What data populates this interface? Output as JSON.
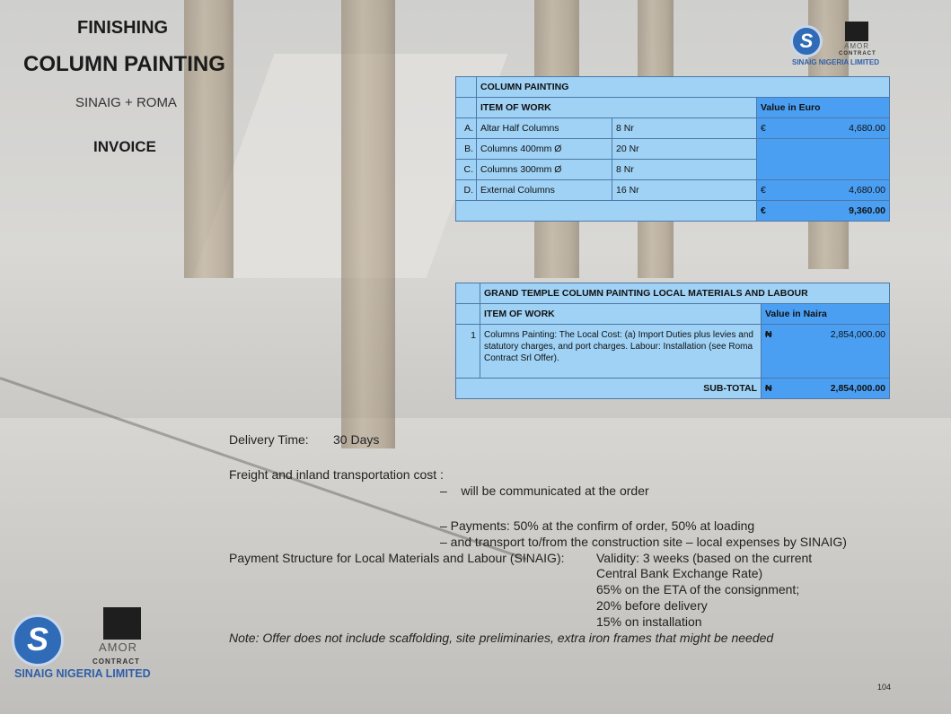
{
  "header": {
    "title_line1": "FINISHING",
    "title_line2": "COLUMN PAINTING",
    "subtitle": "SINAIG + ROMA",
    "doc_type": "INVOICE"
  },
  "logos": {
    "sinaig_name": "SINAIG NIGERIA LIMITED",
    "roma_word": "AMOR",
    "roma_contract": "CONTRACT",
    "badge_letter": "S"
  },
  "table1": {
    "title": "COLUMN PAINTING",
    "col_item": "ITEM OF WORK",
    "col_value": "Value in Euro",
    "rows": [
      {
        "idx": "A.",
        "item": "Altar Half Columns",
        "qty": "8 Nr",
        "cur": "€",
        "value": "4,680.00"
      },
      {
        "idx": "B.",
        "item": "Columns 400mm Ø",
        "qty": "20 Nr",
        "cur": "",
        "value": ""
      },
      {
        "idx": "C.",
        "item": "Columns 300mm Ø",
        "qty": "8 Nr",
        "cur": "",
        "value": ""
      },
      {
        "idx": "D.",
        "item": "External Columns",
        "qty": "16 Nr",
        "cur": "€",
        "value": "4,680.00"
      }
    ],
    "total_cur": "€",
    "total": "9,360.00"
  },
  "table2": {
    "title": "GRAND TEMPLE COLUMN PAINTING  LOCAL MATERIALS AND LABOUR",
    "col_item": "ITEM OF WORK",
    "col_value": "Value in Naira",
    "row_idx": "1",
    "row_text": "Columns Painting: The Local Cost: (a) Import Duties plus levies and statutory charges, and port charges. Labour: Installation (see Roma Contract Srl Offer).",
    "row_cur": "₦",
    "row_value": "2,854,000.00",
    "subtotal_label": "SUB-TOTAL",
    "subtotal_cur": "₦",
    "subtotal_value": "2,854,000.00"
  },
  "terms": {
    "delivery_label": "Delivery Time:",
    "delivery_value": "30 Days",
    "freight_label": "Freight and inland transportation cost :",
    "freight_bullet": "–    will be communicated at the order",
    "payments_bullet": "–  Payments: 50% at the confirm of order, 50% at loading",
    "transport_bullet": "–  and transport to/from the construction site – local expenses by SINAIG)",
    "payment_structure_label": "Payment Structure for Local Materials and Labour (SINAIG):",
    "validity_line1": "Validity: 3 weeks (based on the current",
    "validity_line2": "Central Bank Exchange Rate)",
    "line_65": "65% on the ETA of the consignment;",
    "line_20": "20% before delivery",
    "line_15": "15% on installation",
    "note": "Note: Offer does not include scaffolding, site preliminaries, extra iron frames that might be needed"
  },
  "page_number": "104"
}
